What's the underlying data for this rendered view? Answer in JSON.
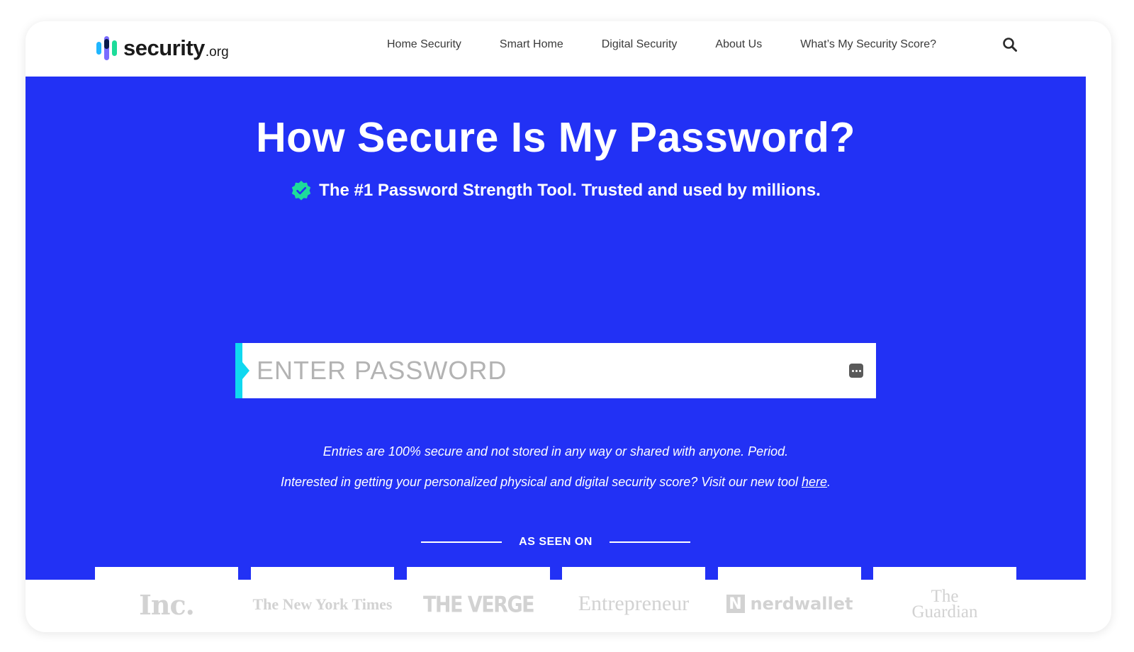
{
  "header": {
    "logo_text": "security",
    "logo_tld": ".org",
    "nav": [
      {
        "label": "Home Security"
      },
      {
        "label": "Smart Home"
      },
      {
        "label": "Digital Security"
      },
      {
        "label": "About Us"
      },
      {
        "label": "What’s My Security Score?"
      }
    ],
    "search_icon": "search-icon"
  },
  "hero": {
    "title": "How Secure Is My Password?",
    "subtitle": "The #1 Password Strength Tool. Trusted and used by millions.",
    "badge_icon": "verified-badge-icon",
    "password_placeholder": "ENTER PASSWORD",
    "note_secure": "Entries are 100% secure and not stored in any way or shared with anyone. Period.",
    "note_score_prefix": "Interested in getting your personalized physical and digital security score? Visit our new tool ",
    "note_score_link": "here",
    "note_score_suffix": ".",
    "as_seen_on": "AS SEEN ON"
  },
  "press": [
    {
      "name": "Inc."
    },
    {
      "name": "The New York Times"
    },
    {
      "name": "THE VERGE"
    },
    {
      "name": "Entrepreneur"
    },
    {
      "name": "nerdwallet"
    },
    {
      "name_line1": "The",
      "name_line2": "Guardian"
    }
  ],
  "colors": {
    "hero_bg": "#2231f5",
    "accent": "#10d8f0",
    "badge": "#1ddc9a"
  }
}
